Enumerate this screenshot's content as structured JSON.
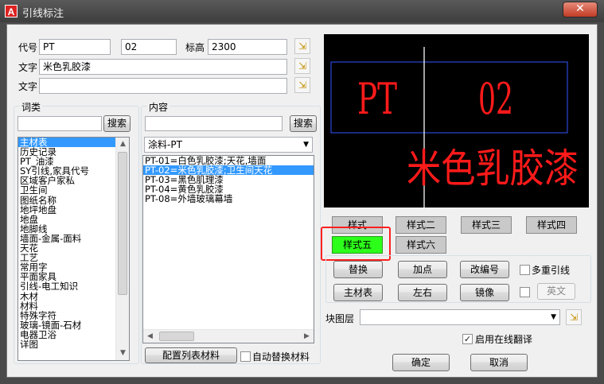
{
  "window": {
    "title": "引线标注",
    "app_icon": "A",
    "close_glyph": "✕"
  },
  "fields": {
    "code_label": "代号",
    "code_value": "PT",
    "number_value": "02",
    "elevation_label": "标高",
    "elevation_value": "2300",
    "text1_label": "文字",
    "text1_value": "米色乳胶漆",
    "text2_label": "文字",
    "text2_value": ""
  },
  "category": {
    "title": "词类",
    "search_label": "搜索",
    "items": [
      "主材表",
      "历史记录",
      "PT_油漆",
      "SY引线,家具代号",
      "区域客户家私",
      "卫生间",
      "图纸名称",
      "地坪地盘",
      "地盘",
      "地脚线",
      "墙面-金属-面料",
      "天花",
      "工艺",
      "常用字",
      "平面家具",
      "引线-电工知识",
      "木材",
      "材料",
      "特殊字符",
      "玻璃-镜面-石材",
      "电器卫浴",
      "详图"
    ],
    "selected": 0
  },
  "content": {
    "title": "内容",
    "search_label": "搜索",
    "combo_value": "涂料-PT",
    "items": [
      "PT-01=白色乳胶漆;天花,墙面",
      "PT-02=米色乳胶漆;卫生间天花",
      "PT-03=黑色肌理漆",
      "PT-04=黄色乳胶漆",
      "PT-08=外墙玻璃幕墙"
    ],
    "selected": 1,
    "config_button": "配置列表材料",
    "auto_replace_label": "自动替换材料"
  },
  "preview": {
    "code": "PT",
    "number": "02",
    "text": "米色乳胶漆",
    "text_color": "#ff1a1a",
    "frame_color": "#3355ff"
  },
  "styles": {
    "buttons": [
      "样式",
      "样式二",
      "样式三",
      "样式四",
      "样式五",
      "样式六"
    ],
    "active": 4
  },
  "actions": {
    "replace": "替换",
    "add_point": "加点",
    "renumber": "改编号",
    "multi_leader": "多重引线",
    "main_table": "主材表",
    "left_right": "左右",
    "mirror": "镜像",
    "english": "英文"
  },
  "block_layer": {
    "label": "块图层",
    "value": ""
  },
  "online_translate": {
    "label": "启用在线翻译",
    "checked": true
  },
  "footer": {
    "ok": "确定",
    "cancel": "取消"
  },
  "icons": {
    "pick": "cursor-pick-icon",
    "dropdown": "chevron-down-icon",
    "app": "autocad-icon",
    "close": "close-icon"
  }
}
